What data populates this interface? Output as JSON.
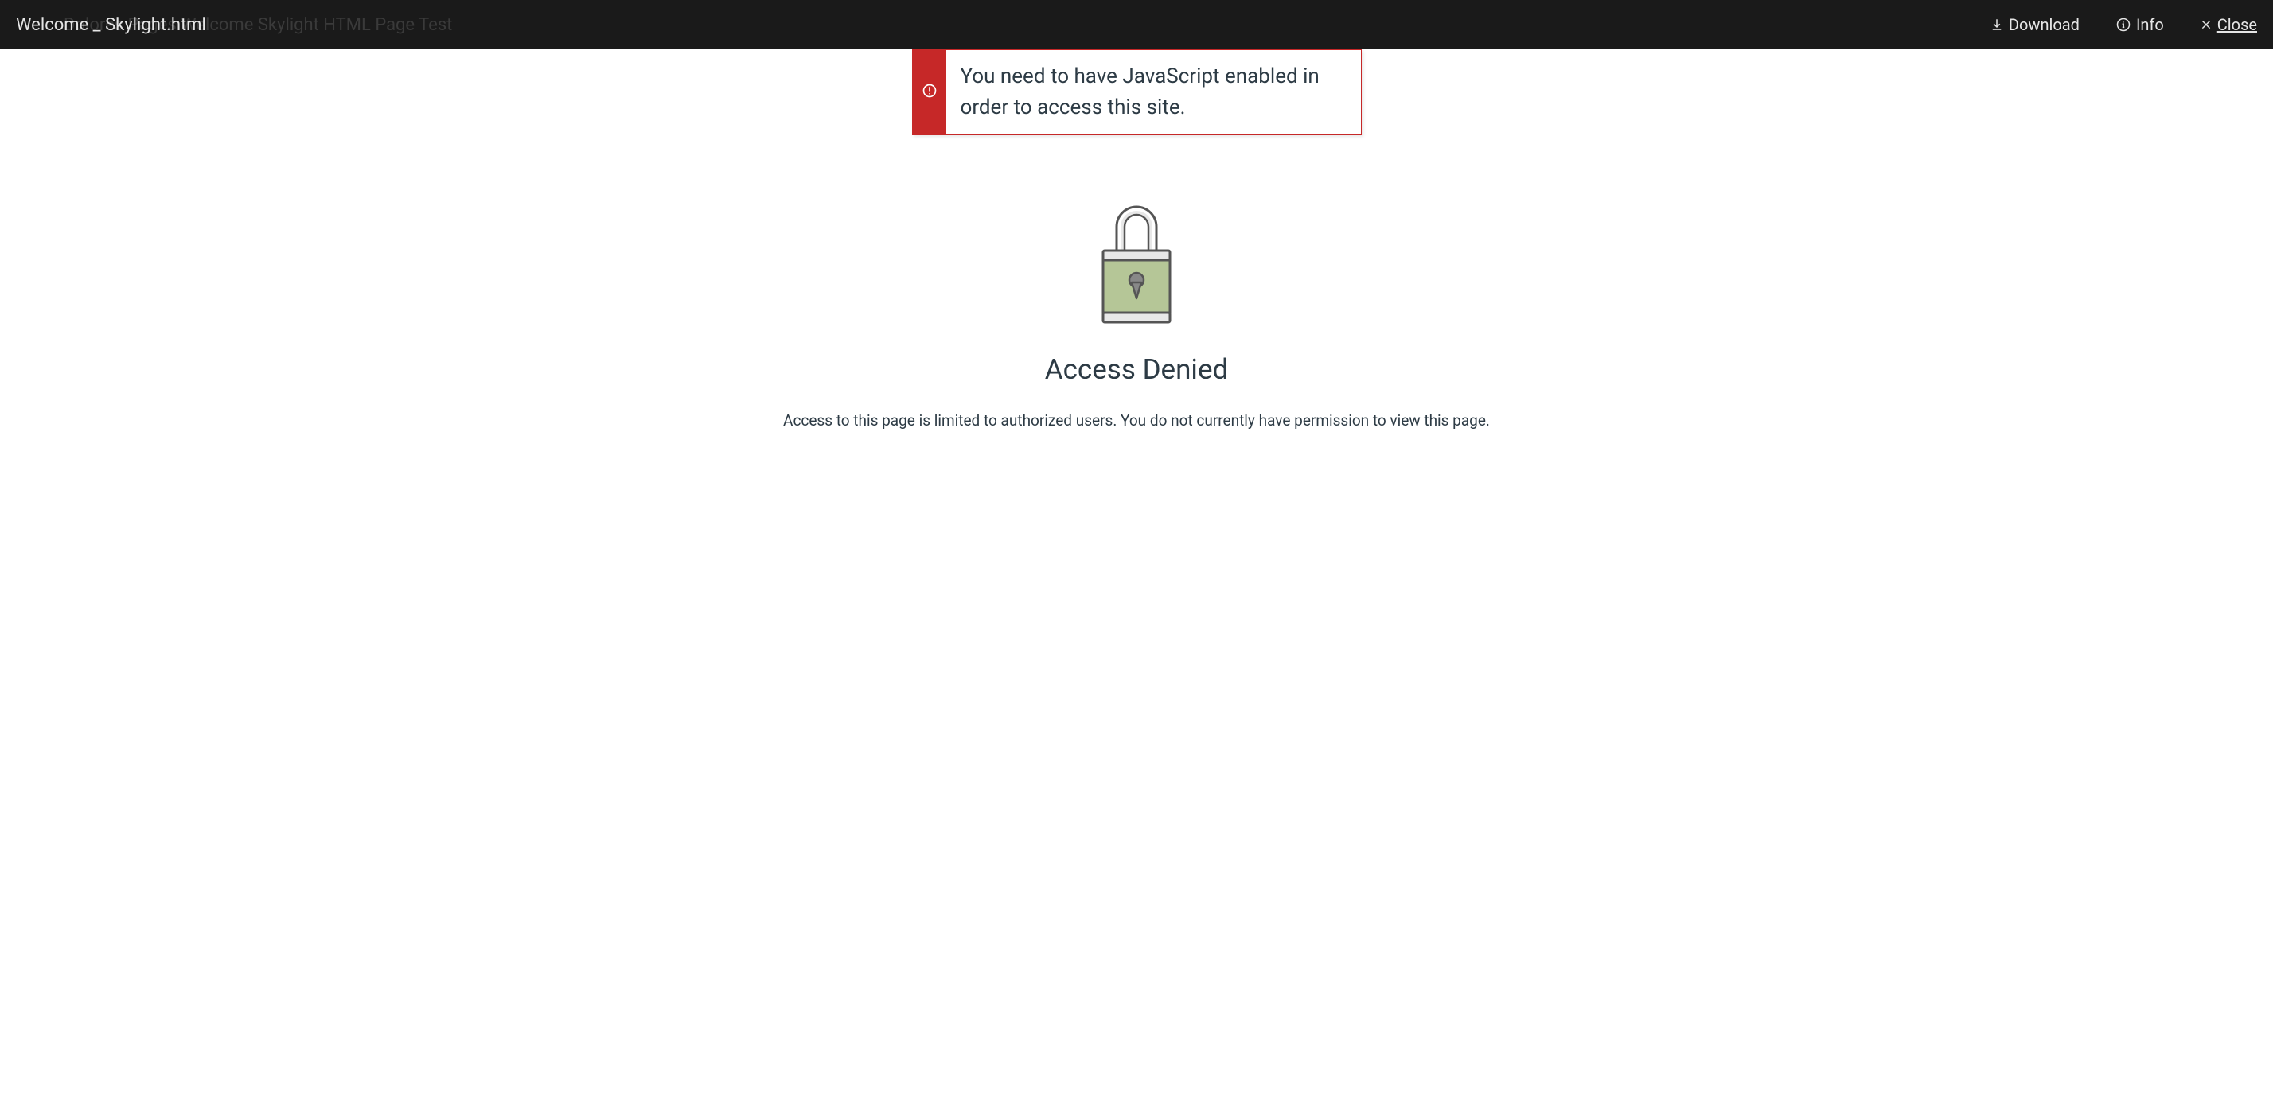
{
  "topbar": {
    "file_title": "Welcome _ Skylight.html",
    "bg_breadcrumb": "Dolores    Pages    Welcome Skylight HTML Page Test",
    "download_label": "Download",
    "info_label": "Info",
    "close_label": "Close"
  },
  "alert": {
    "message": "You need to have JavaScript enabled in order to access this site."
  },
  "denied": {
    "heading": "Access Denied",
    "message": "Access to this page is limited to authorized users. You do not currently have permission to view this page."
  }
}
